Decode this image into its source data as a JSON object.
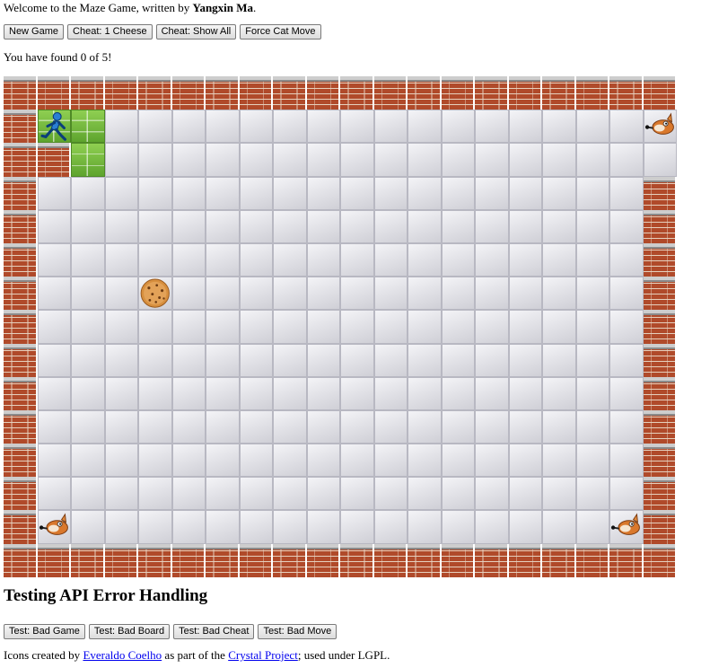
{
  "header": {
    "intro_prefix": "Welcome to the Maze Game, written by ",
    "author": "Yangxin Ma",
    "intro_suffix": "."
  },
  "controls": {
    "new_game": "New Game",
    "cheat_one": "Cheat: 1 Cheese",
    "cheat_all": "Cheat: Show All",
    "force_cat": "Force Cat Move"
  },
  "status": {
    "prefix": "You have found ",
    "found": "0",
    "middle": " of ",
    "total": "5",
    "suffix": "!"
  },
  "maze": {
    "cols": 20,
    "rows": 15,
    "grid": [
      "####################",
      "#RG................C",
      "##G.................",
      "#..................#",
      "#..................#",
      "#..................#",
      "#...K..............#",
      "#..................#",
      "#..................#",
      "#..................#",
      "#..................#",
      "#..................#",
      "#..................#",
      "#C................C#",
      "####################"
    ],
    "legend": {
      "#": "brick-wall",
      ".": "floor-tile",
      "G": "explored-grass",
      "R": "mouse-runner",
      "C": "cat",
      "K": "cheese-cookie"
    }
  },
  "api": {
    "heading": "Testing API Error Handling",
    "bad_game": "Test: Bad Game",
    "bad_board": "Test: Bad Board",
    "bad_cheat": "Test: Bad Cheat",
    "bad_move": "Test: Bad Move"
  },
  "credits": {
    "prefix": "Icons created by ",
    "author_link": "Everaldo Coelho",
    "middle": " as part of the ",
    "project_link": "Crystal Project",
    "suffix": "; used under LGPL."
  },
  "colors": {
    "brick": "#b04a2a",
    "floor": "#e3e3e8",
    "grass": "#6fb83a",
    "link": "#0000ee"
  }
}
